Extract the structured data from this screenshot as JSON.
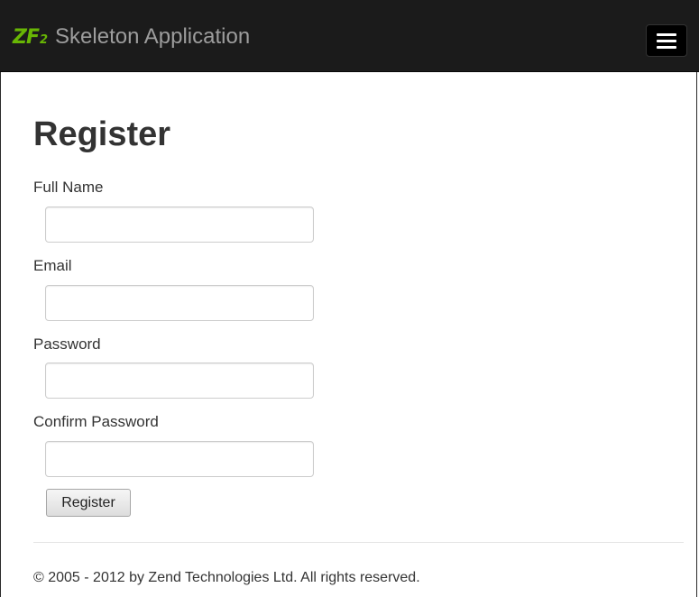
{
  "navbar": {
    "logo_main": "ZF",
    "logo_sub": "2",
    "brand": "Skeleton Application",
    "menu_icon": "hamburger-menu-icon"
  },
  "page": {
    "title": "Register"
  },
  "form": {
    "fields": [
      {
        "label": "Full Name",
        "value": "",
        "placeholder": ""
      },
      {
        "label": "Email",
        "value": "",
        "placeholder": ""
      },
      {
        "label": "Password",
        "value": "",
        "placeholder": ""
      },
      {
        "label": "Confirm Password",
        "value": "",
        "placeholder": ""
      }
    ],
    "submit_label": "Register"
  },
  "footer": {
    "text": "© 2005 - 2012 by Zend Technologies Ltd. All rights reserved."
  },
  "colors": {
    "navbar_bg": "#1b1b1b",
    "brand_text": "#9d9d9d",
    "logo_green": "#68b604",
    "text": "#333333"
  }
}
